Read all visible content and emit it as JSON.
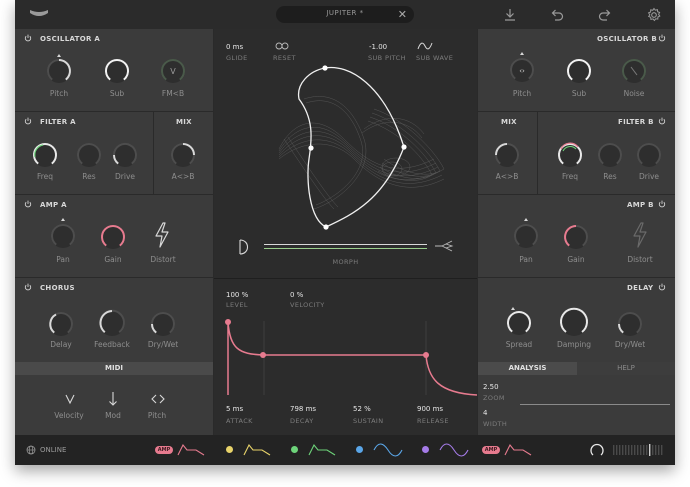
{
  "topbar": {
    "preset_name": "JUPITER *",
    "close_symbol": "✕",
    "icons": [
      "logo-icon",
      "download-icon",
      "undo-icon",
      "redo-icon",
      "settings-icon"
    ]
  },
  "osc_a": {
    "title": "OSCILLATOR A",
    "knobs": [
      "Pitch",
      "Sub",
      "FM<B"
    ]
  },
  "filter_a": {
    "title": "FILTER A",
    "knobs": [
      "Freq",
      "Res",
      "Drive"
    ]
  },
  "mix_a": {
    "title": "MIX",
    "knob": "A<>B"
  },
  "amp_a": {
    "title": "AMP A",
    "knobs": [
      "Pan",
      "Gain",
      "Distort"
    ]
  },
  "chorus": {
    "title": "CHORUS",
    "knobs": [
      "Delay",
      "Feedback",
      "Dry/Wet"
    ]
  },
  "midi": {
    "title": "MIDI",
    "items": [
      "Velocity",
      "Mod",
      "Pitch"
    ]
  },
  "osc_b": {
    "title": "OSCILLATOR B",
    "knobs": [
      "Pitch",
      "Sub",
      "Noise"
    ]
  },
  "filter_b": {
    "title": "FILTER B",
    "knobs": [
      "Freq",
      "Res",
      "Drive"
    ]
  },
  "mix_b": {
    "title": "MIX",
    "knob": "A<>B"
  },
  "amp_b": {
    "title": "AMP B",
    "knobs": [
      "Pan",
      "Gain",
      "Distort"
    ]
  },
  "delay": {
    "title": "DELAY",
    "knobs": [
      "Spread",
      "Damping",
      "Dry/Wet"
    ]
  },
  "center": {
    "glide_value": "0 ms",
    "glide_label": "GLIDE",
    "reset_label": "RESET",
    "sub_pitch_value": "-1.00",
    "sub_pitch_label": "SUB PITCH",
    "sub_wave_label": "SUB WAVE",
    "morph_label": "MORPH",
    "level_value": "100 %",
    "level_label": "LEVEL",
    "velocity_value": "0 %",
    "velocity_label": "VELOCITY",
    "attack_value": "5 ms",
    "attack_label": "ATTACK",
    "decay_value": "798 ms",
    "decay_label": "DECAY",
    "sustain_value": "52 %",
    "sustain_label": "SUSTAIN",
    "release_value": "900 ms",
    "release_label": "RELEASE"
  },
  "analysis": {
    "tab_analysis": "ANALYSIS",
    "tab_help": "HELP",
    "zoom_value": "2.50",
    "zoom_label": "ZOOM",
    "width_value": "4",
    "width_label": "WIDTH"
  },
  "bottombar": {
    "status": "ONLINE",
    "amp_badge": "AMP",
    "colors": {
      "pink": "#e77b8f",
      "yellow": "#e8d36a",
      "green": "#6dd37a",
      "blue": "#5aa6e8",
      "purple": "#a57be8"
    }
  },
  "colors": {
    "accent_pink": "#e77b8f",
    "accent_green": "#6dd37a",
    "panel": "#3b3b3b",
    "center": "#2c2c2c"
  }
}
